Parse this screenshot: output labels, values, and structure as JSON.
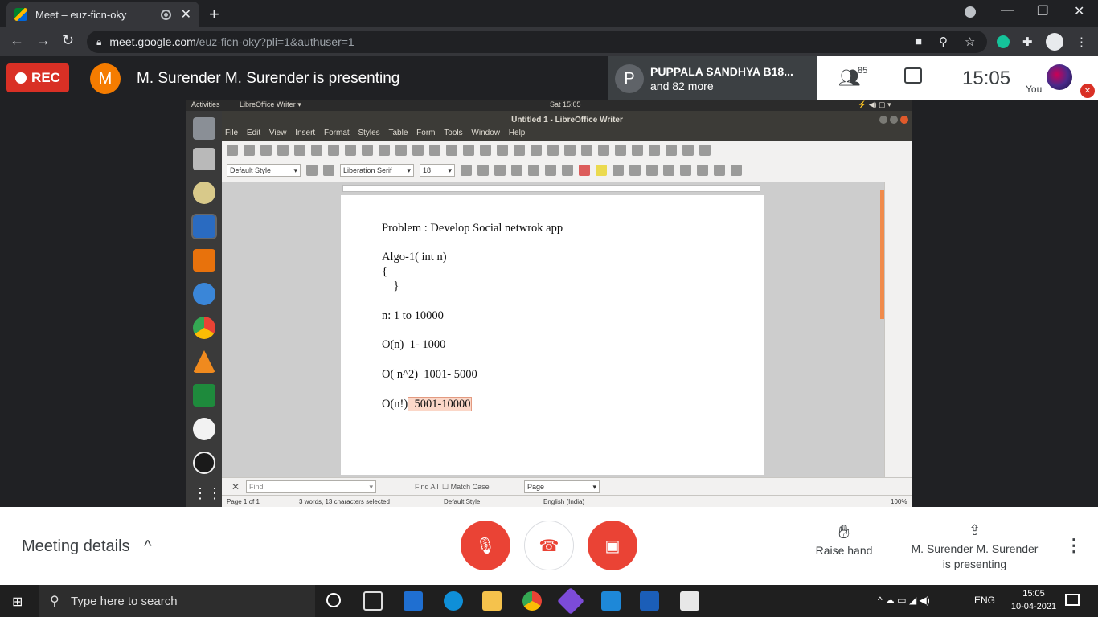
{
  "browser": {
    "tab_title": "Meet – euz-ficn-oky",
    "url_host": "meet.google.com",
    "url_path": "/euz-ficn-oky?pli=1&authuser=1"
  },
  "meet_top": {
    "rec_label": "REC",
    "presenter_initial": "M",
    "presenting_text": "M. Surender M. Surender is presenting",
    "participant_initial": "P",
    "participant_name": "PUPPALA SANDHYA B18...",
    "participant_more": "and 82 more",
    "people_count": "85",
    "time": "15:05",
    "you_label": "You"
  },
  "ubuntu": {
    "activities": "Activities",
    "app_menu": "LibreOffice Writer ▾",
    "clock": "Sat 15:05",
    "window_title": "Untitled 1 - LibreOffice Writer",
    "menu": [
      "File",
      "Edit",
      "View",
      "Insert",
      "Format",
      "Styles",
      "Table",
      "Form",
      "Tools",
      "Window",
      "Help"
    ],
    "para_style": "Default Style",
    "font_name": "Liberation Serif",
    "font_size": "18"
  },
  "document": {
    "lines": [
      "Problem : Develop Social netwrok app",
      "Algo-1( int n)",
      "{",
      "    }",
      "n: 1 to 10000",
      "O(n)  1- 1000",
      "O( n^2)  1001- 5000",
      "O(n!)"
    ],
    "highlight": "  5001-10000"
  },
  "findbar": {
    "placeholder": "Find",
    "find_all": "Find All",
    "match_case": "Match Case",
    "page_select": "Page"
  },
  "statusbar": {
    "page": "Page 1 of 1",
    "words": "3 words, 13 characters selected",
    "style": "Default Style",
    "language": "English (India)",
    "zoom": "100%"
  },
  "meet_bottom": {
    "meeting_details": "Meeting details",
    "raise_hand": "Raise hand",
    "presenting_line1": "M. Surender M. Surender",
    "presenting_line2": "is presenting"
  },
  "taskbar": {
    "search_placeholder": "Type here to search",
    "lang": "ENG",
    "time": "15:05",
    "date": "10-04-2021"
  },
  "colors": {
    "rec_red": "#d93025",
    "mic_off_red": "#ea4335",
    "highlight": "#fbd7c8",
    "vertical_scroll_accent": "#f08a4b"
  }
}
